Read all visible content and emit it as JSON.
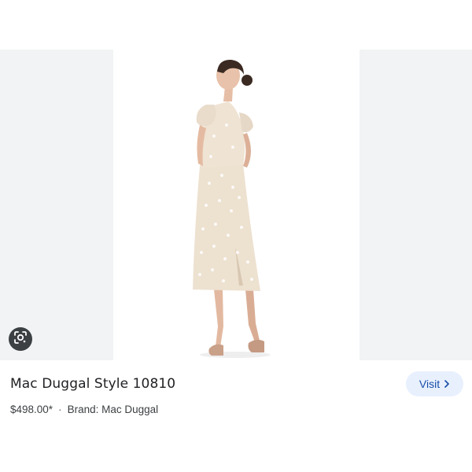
{
  "product": {
    "title": "Mac Duggal Style 10810",
    "price": "$498.00*",
    "separator": "·",
    "brand": "Brand: Mac Duggal"
  },
  "actions": {
    "visit_label": "Visit",
    "visit_icon": "chevron-right-icon",
    "lens_icon": "google-lens-icon"
  },
  "colors": {
    "side_panel": "#f1f3f4",
    "visit_bg": "#e8f0fe",
    "visit_text": "#174ea6",
    "lens_bg": "#3c4043"
  }
}
